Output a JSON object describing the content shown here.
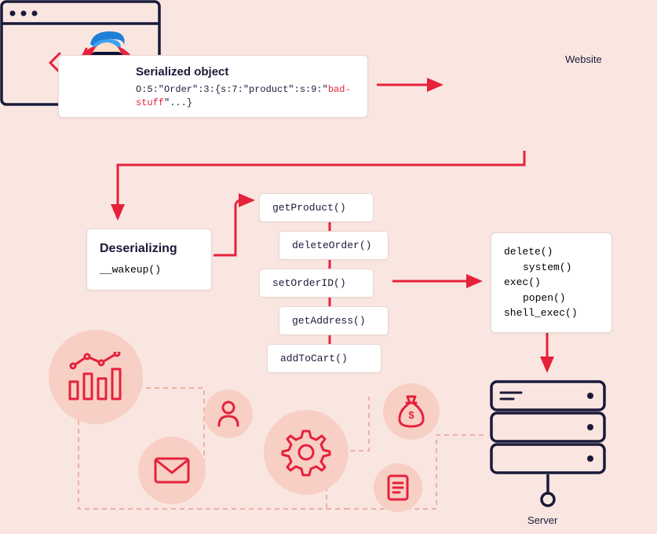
{
  "hacker": {
    "title": "Serialized object",
    "code_prefix": "O:5:\"Order\":3:{s:7:\"product\":s:9:\"",
    "code_bad": "bad-stuff",
    "code_suffix": "\"...}"
  },
  "browser": {
    "label": "Website"
  },
  "deserializing": {
    "title": "Deserializing",
    "hook": "__wakeup()"
  },
  "methods": {
    "m1": "getProduct()",
    "m2": "deleteOrder()",
    "m3": "setOrderID()",
    "m4": "getAddress()",
    "m5": "addToCart()"
  },
  "danger": {
    "l1": "delete()",
    "l2": "system()",
    "l3": "exec()",
    "l4": "popen()",
    "l5": "shell_exec()"
  },
  "server": {
    "label": "Server"
  },
  "icons": {
    "analytics": "analytics-icon",
    "user": "user-icon",
    "mail": "mail-icon",
    "gear": "gear-icon",
    "moneybag": "moneybag-icon",
    "document": "document-icon"
  }
}
